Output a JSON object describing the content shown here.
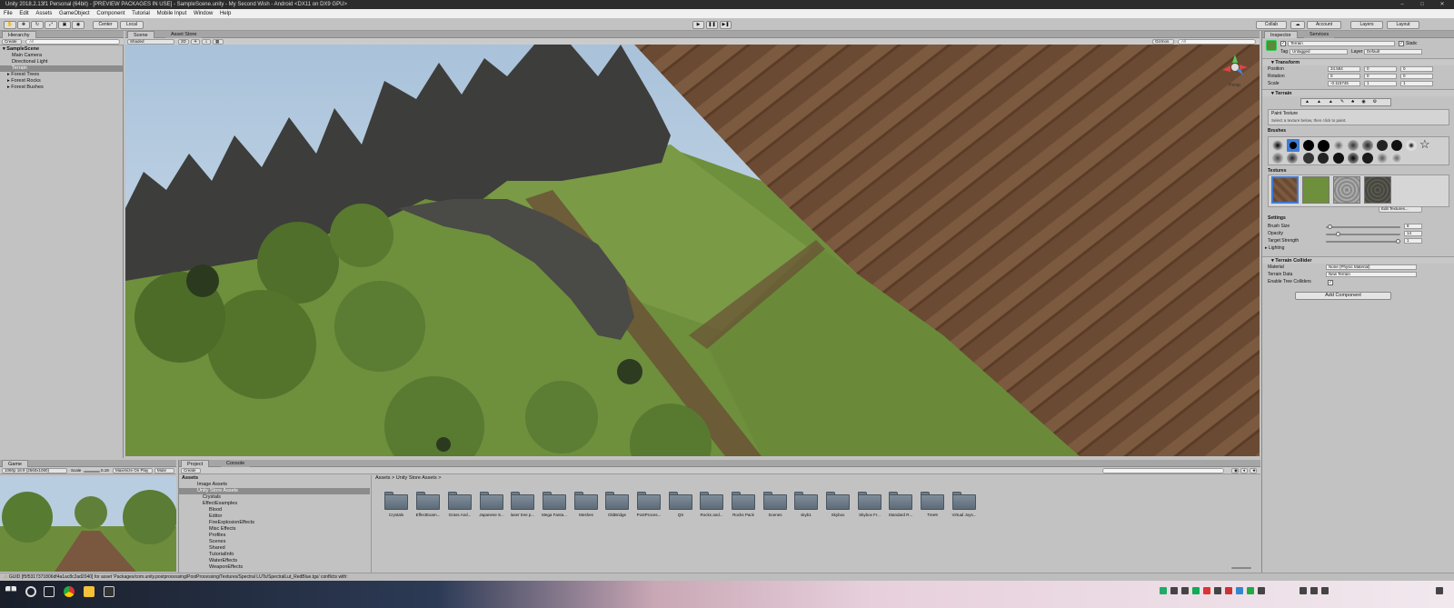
{
  "window": {
    "title": "Unity 2018.2.13f1 Personal (64bit) - [PREVIEW PACKAGES IN USE] - SampleScene.unity - My Second Wish - Android <DX11 on DX9 GPU>"
  },
  "menu": [
    "File",
    "Edit",
    "Assets",
    "GameObject",
    "Component",
    "Tutorial",
    "Mobile Input",
    "Window",
    "Help"
  ],
  "toolbar": {
    "pivot": "Center",
    "space": "Local",
    "collab": "Collab",
    "account": "Account",
    "layers": "Layers",
    "layout": "Layout"
  },
  "hierarchy": {
    "tab": "Hierarchy",
    "create": "Create",
    "search_placeholder": "All",
    "scene": "SampleScene",
    "items": [
      "Main Camera",
      "Directional Light",
      "Terrain",
      "Forest Trees",
      "Forest Rocks",
      "Forest Bushes"
    ]
  },
  "scene_view": {
    "tabs": [
      "Scene",
      "Asset Store"
    ],
    "shading": "Shaded",
    "mode2d": "2D",
    "gizmos": "Gizmos",
    "search_placeholder": "All",
    "persp": "Persp"
  },
  "game_view": {
    "tab": "Game",
    "resolution": "1080p 16:9 (2560x1080)",
    "scale_label": "Scale",
    "scale_value": "0.19",
    "maximize": "Maximize On Play",
    "mute": "Mute Au"
  },
  "project": {
    "tabs": [
      "Project",
      "Console"
    ],
    "create": "Create",
    "breadcrumb": "Assets > Unity Store Assets >",
    "tree": [
      "Assets",
      "Image Assets",
      "Unity Store Assets",
      "Crystals",
      "EffectExamples",
      "Blood",
      "Editor",
      "FireExplosionEffects",
      "Misc Effects",
      "Profiles",
      "Scenes",
      "Shared",
      "TutorialInfo",
      "WaterEffects",
      "WeaponEffects"
    ],
    "folders": [
      "Crystals",
      "EffectExam...",
      "Grass And...",
      "Japanese S...",
      "laser tree p...",
      "Mega Fanta...",
      "Meshes",
      "OldBridge",
      "PostProces...",
      "QS",
      "Rocks and...",
      "Rocks Pack",
      "Scenes",
      "skyb1",
      "Skybox",
      "Skybox Fr...",
      "Standard R...",
      "Tree9",
      "Virtual Joys..."
    ]
  },
  "inspector": {
    "tabs": [
      "Inspector",
      "Services"
    ],
    "object_name": "Terrain",
    "static": "Static",
    "tag_label": "Tag",
    "tag": "Untagged",
    "layer_label": "Layer",
    "layer": "Default",
    "transform": {
      "title": "Transform",
      "position_label": "Position",
      "rotation_label": "Rotation",
      "scale_label": "Scale",
      "position": [
        "34.584",
        "0",
        "0"
      ],
      "rotation": [
        "0",
        "0",
        "0"
      ],
      "scale": [
        "-0.115745",
        "1",
        "1"
      ]
    },
    "terrain": {
      "title": "Terrain",
      "tool_name": "Paint Texture",
      "tool_hint": "Select a texture below, then click to paint.",
      "brushes_label": "Brushes",
      "textures_label": "Textures",
      "edit_textures": "Edit Textures...",
      "settings_label": "Settings",
      "brush_size_label": "Brush Size",
      "brush_size": "8",
      "opacity_label": "Opacity",
      "opacity": "14",
      "target_strength_label": "Target Strength",
      "target_strength": "1",
      "brush_size_fraction": 0.03,
      "opacity_fraction": 0.14,
      "target_strength_fraction": 1.0,
      "lighting_label": "Lighting"
    },
    "collider": {
      "title": "Terrain Collider",
      "material_label": "Material",
      "material": "None (Physic Material)",
      "data_label": "Terrain Data",
      "data": "New Terrain",
      "trees_label": "Enable Tree Colliders"
    },
    "add_component": "Add Component"
  },
  "status": {
    "message": "GUID [f5f5317371806df4a1ac8c2ad2040] for asset 'Packages/com.unity.postprocessing/PostProcessing/Textures/Spectral LUTs/SpectralLut_RedBlue.tga' conflicts with:"
  },
  "colors": {
    "selection": "#3d7bd9",
    "panel": "#c2c2c2",
    "ground": "#6b4a33",
    "grass": "#6e8f3c"
  }
}
